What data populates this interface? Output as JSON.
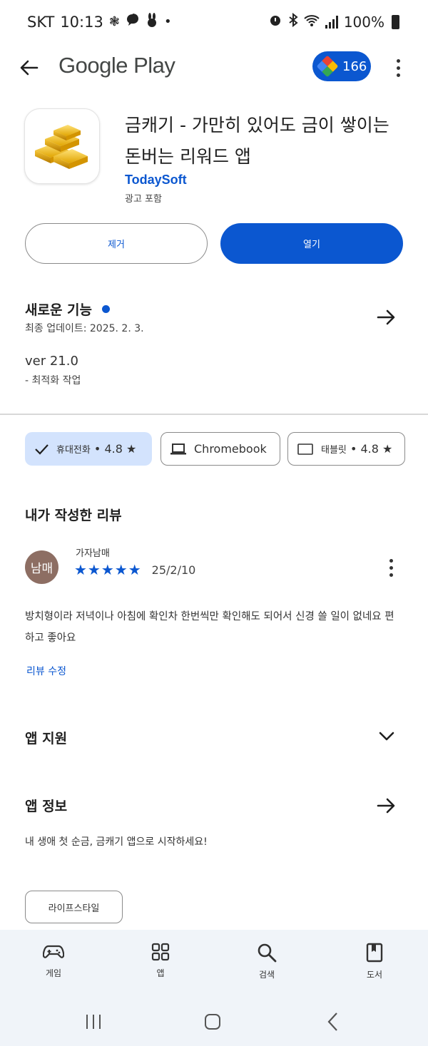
{
  "status_bar": {
    "carrier": "SKT",
    "time": "10:13",
    "battery": "100%"
  },
  "app_bar": {
    "brand": "Google Play",
    "points": "166"
  },
  "app": {
    "title": "금캐기 - 가만히 있어도 금이 쌓이는 돈버는 리워드 앱",
    "developer": "TodaySoft",
    "ads_note": "광고 포함",
    "uninstall_label": "제거",
    "open_label": "열기"
  },
  "whats_new": {
    "title": "새로운 기능",
    "last_updated": "최종 업데이트: 2025. 2. 3.",
    "version": "ver 21.0",
    "notes": "- 최적화 작업"
  },
  "device_chips": [
    {
      "label": "휴대전화",
      "rating": "4.8",
      "selected": true
    },
    {
      "label": "Chromebook"
    },
    {
      "label": "태블릿",
      "rating": "4.8"
    }
  ],
  "my_review": {
    "section_title": "내가 작성한 리뷰",
    "avatar_text": "남매",
    "reviewer": "가자남매",
    "stars": "★★★★★",
    "date": "25/2/10",
    "body": "방치형이라 저녁이나 아침에 확인차 한번씩만 확인해도 되어서 신경 쓸 일이 없네요 편하고 좋아요",
    "edit_label": "리뷰 수정"
  },
  "app_support": {
    "title": "앱 지원"
  },
  "app_info": {
    "title": "앱 정보",
    "description": "내 생애 첫 순금, 금캐기 앱으로 시작하세요!",
    "tag": "라이프스타일"
  },
  "bottom_nav": [
    {
      "label": "게임",
      "icon": "gamepad-icon"
    },
    {
      "label": "앱",
      "icon": "apps-grid-icon"
    },
    {
      "label": "검색",
      "icon": "search-icon"
    },
    {
      "label": "도서",
      "icon": "book-icon"
    }
  ],
  "colors": {
    "accent": "#0b57d0",
    "chip_selected_bg": "#d3e3fd",
    "nav_bg": "#f0f4f9",
    "avatar_bg": "#8d6e63"
  }
}
